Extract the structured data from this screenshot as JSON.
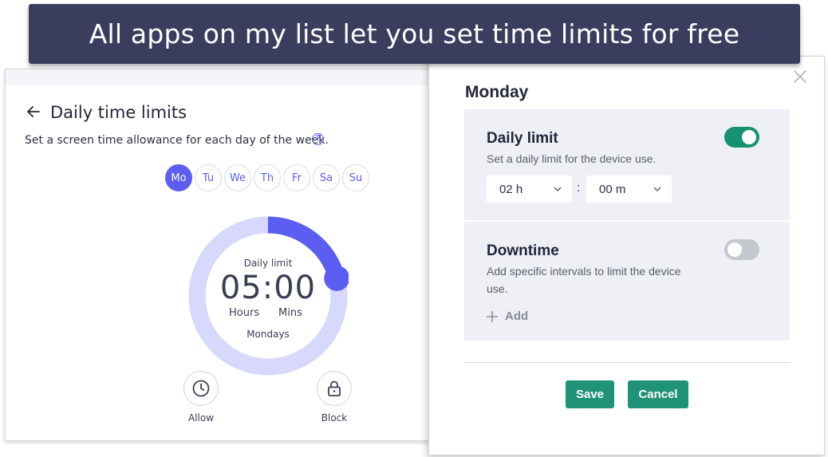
{
  "banner": {
    "text": "All apps on my list let you set time limits for free"
  },
  "left": {
    "title": "Daily time limits",
    "subtitle": "Set a screen time allowance for each day of the week.",
    "help": "?",
    "days": [
      "Mo",
      "Tu",
      "We",
      "Th",
      "Fr",
      "Sa",
      "Su"
    ],
    "active_day": "Mo",
    "dial": {
      "label": "Daily limit",
      "time": "05:00",
      "hours_label": "Hours",
      "mins_label": "Mins",
      "day_label": "Mondays",
      "progress_fraction": 0.21
    },
    "actions": {
      "allow": "Allow",
      "block": "Block"
    }
  },
  "modal": {
    "day": "Monday",
    "daily_limit": {
      "title": "Daily limit",
      "desc": "Set a daily limit for the device use.",
      "enabled": true,
      "hours_value": "02 h",
      "minutes_value": "00 m",
      "separator": ":"
    },
    "downtime": {
      "title": "Downtime",
      "desc_line1": "Add specific intervals to limit the device",
      "desc_line2": "use.",
      "enabled": false,
      "add_label": "Add"
    },
    "save_label": "Save",
    "cancel_label": "Cancel"
  },
  "colors": {
    "banner_bg": "#3b3d5e",
    "accent_purple": "#5b5ef0",
    "ring_track": "#d7d8fb",
    "toggle_on": "#169273",
    "button_green": "#1f9278",
    "section_bg": "#eef0f6"
  }
}
